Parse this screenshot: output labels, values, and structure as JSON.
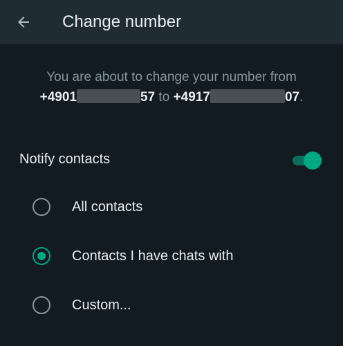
{
  "header": {
    "title": "Change number",
    "back_icon": "arrow-left-icon"
  },
  "info": {
    "prefix": "You are about to change your number from",
    "old_number_start": "+4901",
    "old_number_end": "57",
    "connector": "to",
    "new_number_start": "+4917",
    "new_number_end": "07",
    "suffix": "."
  },
  "notify": {
    "label": "Notify contacts",
    "enabled": true
  },
  "options": [
    {
      "label": "All contacts",
      "selected": false
    },
    {
      "label": "Contacts I have chats with",
      "selected": true
    },
    {
      "label": "Custom...",
      "selected": false
    }
  ],
  "colors": {
    "background": "#121b22",
    "appbar": "#202c33",
    "accent": "#00a884",
    "primary_text": "#e9edef",
    "secondary_text": "#8696a0"
  }
}
